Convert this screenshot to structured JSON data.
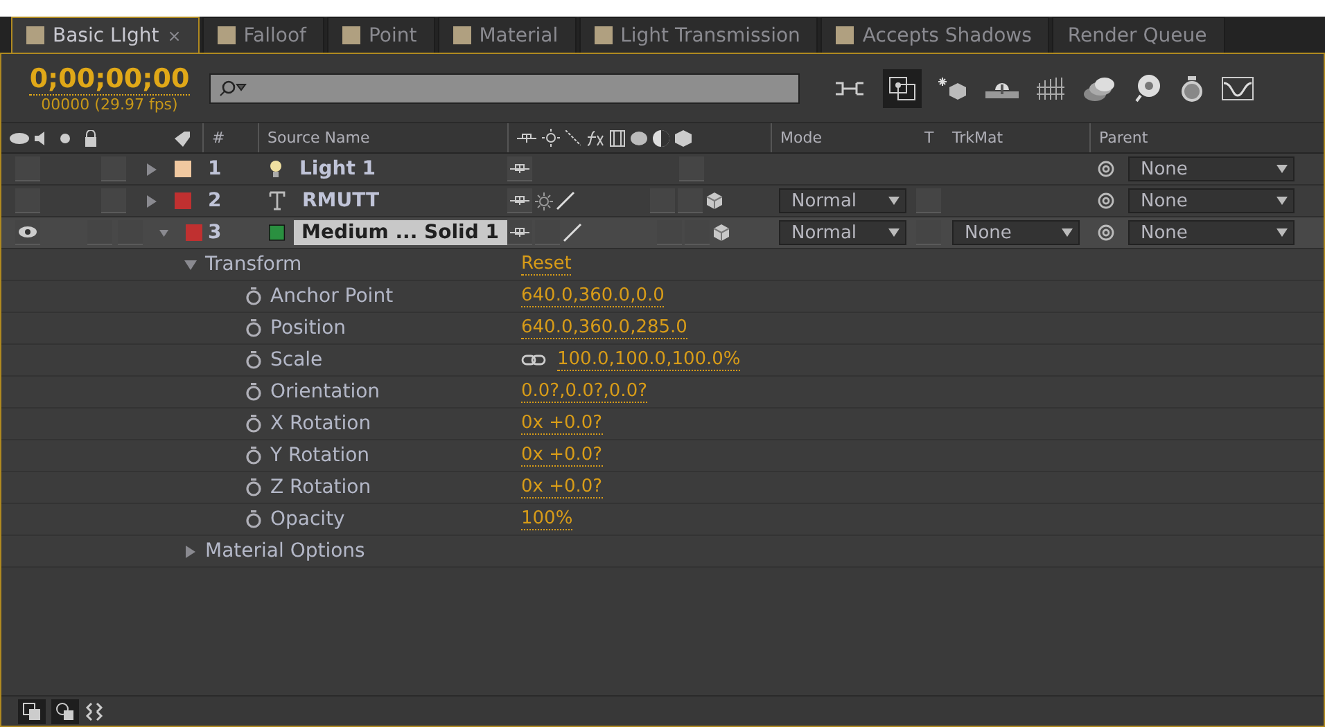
{
  "tabs": [
    {
      "label": "Basic LIght",
      "kind": "comp",
      "selected": true,
      "close": "×"
    },
    {
      "label": "Falloof",
      "kind": "comp",
      "selected": false
    },
    {
      "label": "Point",
      "kind": "comp",
      "selected": false
    },
    {
      "label": "Material",
      "kind": "comp",
      "selected": false
    },
    {
      "label": "Light Transmission",
      "kind": "comp",
      "selected": false
    },
    {
      "label": "Accepts Shadows",
      "kind": "comp",
      "selected": false
    },
    {
      "label": "Render Queue",
      "kind": "queue",
      "selected": false
    }
  ],
  "timecode": "0;00;00;00",
  "frame_info": "00000 (29.97 fps)",
  "columns": {
    "number": "#",
    "source_name": "Source Name",
    "mode": "Mode",
    "t": "T",
    "trkmat": "TrkMat",
    "parent": "Parent"
  },
  "layers": [
    {
      "number": "1",
      "name": "Light 1",
      "kind": "light",
      "color": "#f0c8a0",
      "selected": false,
      "expanded": false,
      "visible": false,
      "parent": "None"
    },
    {
      "number": "2",
      "name": "RMUTT",
      "kind": "text",
      "color": "#c03030",
      "selected": false,
      "expanded": false,
      "visible": false,
      "mode": "Normal",
      "parent": "None"
    },
    {
      "number": "3",
      "name": "Medium ... Solid 1",
      "kind": "solid",
      "color": "#c03030",
      "selected": true,
      "expanded": true,
      "visible": true,
      "mode": "Normal",
      "trkmat": "None",
      "parent": "None",
      "properties": [
        {
          "name": "Transform",
          "value": "Reset",
          "expanded": true,
          "children": [
            {
              "name": "Anchor Point",
              "value": "640.0,360.0,0.0"
            },
            {
              "name": "Position",
              "value": "640.0,360.0,285.0"
            },
            {
              "name": "Scale",
              "value": "100.0,100.0,100.0%",
              "linked": true
            },
            {
              "name": "Orientation",
              "value": "0.0?,0.0?,0.0?"
            },
            {
              "name": "X Rotation",
              "value": "0x +0.0?"
            },
            {
              "name": "Y Rotation",
              "value": "0x +0.0?"
            },
            {
              "name": "Z Rotation",
              "value": "0x +0.0?"
            },
            {
              "name": "Opacity",
              "value": "100%"
            }
          ]
        },
        {
          "name": "Material Options",
          "expanded": false
        }
      ]
    }
  ]
}
